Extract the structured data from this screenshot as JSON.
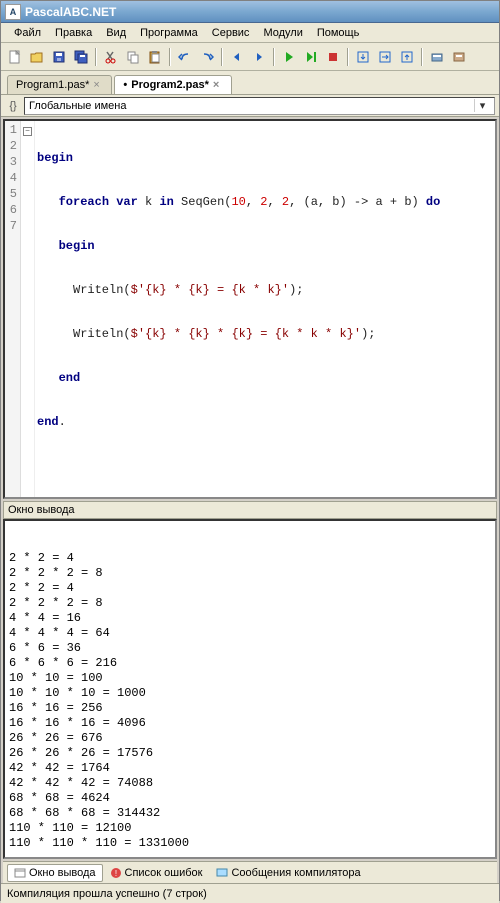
{
  "window": {
    "title": "PascalABC.NET"
  },
  "menu": {
    "file": "Файл",
    "edit": "Правка",
    "view": "Вид",
    "program": "Программа",
    "service": "Сервис",
    "modules": "Модули",
    "help": "Помощь"
  },
  "tabs": {
    "t1": "Program1.pas*",
    "t2": "Program2.pas*",
    "t2dot": "•"
  },
  "scope": {
    "label": "Глобальные имена"
  },
  "code": {
    "l1a": "begin",
    "l2a": "   ",
    "l2b": "foreach",
    "l2c": " ",
    "l2d": "var",
    "l2e": " k ",
    "l2f": "in",
    "l2g": " SeqGen(",
    "l2h": "10",
    "l2i": ", ",
    "l2j": "2",
    "l2k": ", ",
    "l2l": "2",
    "l2m": ", (a, b) -> a + b) ",
    "l2n": "do",
    "l3a": "   ",
    "l3b": "begin",
    "l4a": "     Writeln(",
    "l4b": "$'{k} * {k} = {k * k}'",
    "l4c": ");",
    "l5a": "     Writeln(",
    "l5b": "$'{k} * {k} * {k} = {k * k * k}'",
    "l5c": ");",
    "l6a": "   ",
    "l6b": "end",
    "l7a": "end",
    "l7b": "."
  },
  "gut": {
    "n1": "1",
    "n2": "2",
    "n3": "3",
    "n4": "4",
    "n5": "5",
    "n6": "6",
    "n7": "7"
  },
  "outputPanel": {
    "title": "Окно вывода"
  },
  "out": {
    "l1": "2 * 2 = 4",
    "l2": "2 * 2 * 2 = 8",
    "l3": "2 * 2 = 4",
    "l4": "2 * 2 * 2 = 8",
    "l5": "4 * 4 = 16",
    "l6": "4 * 4 * 4 = 64",
    "l7": "6 * 6 = 36",
    "l8": "6 * 6 * 6 = 216",
    "l9": "10 * 10 = 100",
    "l10": "10 * 10 * 10 = 1000",
    "l11": "16 * 16 = 256",
    "l12": "16 * 16 * 16 = 4096",
    "l13": "26 * 26 = 676",
    "l14": "26 * 26 * 26 = 17576",
    "l15": "42 * 42 = 1764",
    "l16": "42 * 42 * 42 = 74088",
    "l17": "68 * 68 = 4624",
    "l18": "68 * 68 * 68 = 314432",
    "l19": "110 * 110 = 12100",
    "l20": "110 * 110 * 110 = 1331000"
  },
  "bottomtabs": {
    "out": "Окно вывода",
    "err": "Список ошибок",
    "msg": "Сообщения компилятора"
  },
  "status": {
    "text": "Компиляция прошла успешно (7 строк)"
  }
}
